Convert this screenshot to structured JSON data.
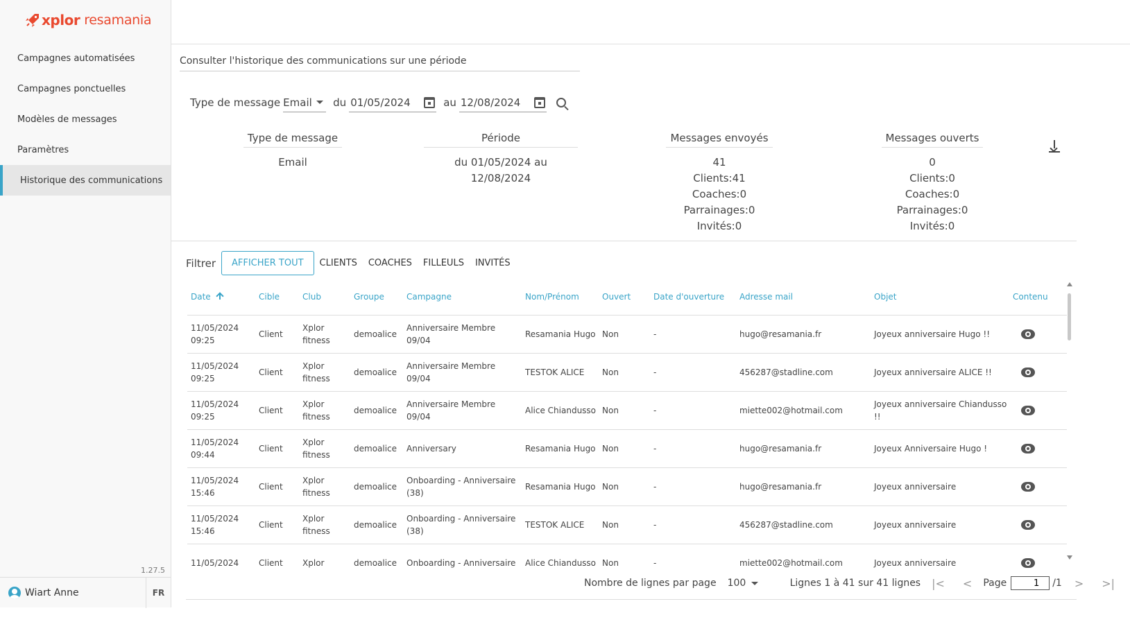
{
  "sidebar": {
    "logo_brand": "xplor",
    "logo_product": "resamania",
    "items": [
      {
        "label": "Campagnes automatisées"
      },
      {
        "label": "Campagnes ponctuelles"
      },
      {
        "label": "Modèles de messages"
      },
      {
        "label": "Paramètres"
      },
      {
        "label": "Historique des communications"
      }
    ],
    "version": "1.27.5",
    "user": "Wiart Anne",
    "lang": "FR"
  },
  "page": {
    "title": "Consulter l'historique des communications sur une période"
  },
  "search": {
    "type_label": "Type de message",
    "type_value": "Email",
    "from_label": "du",
    "from_value": "01/05/2024",
    "to_label": "au",
    "to_value": "12/08/2024"
  },
  "summary": {
    "col1": {
      "head": "Type de message",
      "value": "Email"
    },
    "col2": {
      "head": "Période",
      "value": "du 01/05/2024 au 12/08/2024"
    },
    "col3": {
      "head": "Messages envoyés",
      "lines": [
        "41",
        "Clients:41",
        "Coaches:0",
        "Parrainages:0",
        "Invités:0"
      ]
    },
    "col4": {
      "head": "Messages ouverts",
      "lines": [
        "0",
        "Clients:0",
        "Coaches:0",
        "Parrainages:0",
        "Invités:0"
      ]
    }
  },
  "filter": {
    "label": "Filtrer",
    "chips": [
      "AFFICHER TOUT",
      "CLIENTS",
      "COACHES",
      "FILLEULS",
      "INVITÉS"
    ]
  },
  "table": {
    "headers": [
      "Date",
      "Cible",
      "Club",
      "Groupe",
      "Campagne",
      "Nom/Prénom",
      "Ouvert",
      "Date d'ouverture",
      "Adresse mail",
      "Objet",
      "Contenu"
    ],
    "rows": [
      {
        "date": "11/05/2024",
        "time": "09:25",
        "cible": "Client",
        "club1": "Xplor",
        "club2": "fitness",
        "groupe": "demoalice",
        "campagne": "Anniversaire Membre 09/04",
        "nom": "Resamania Hugo",
        "ouvert": "Non",
        "date_ouv": "-",
        "mail": "hugo@resamania.fr",
        "objet": "Joyeux anniversaire Hugo !!"
      },
      {
        "date": "11/05/2024",
        "time": "09:25",
        "cible": "Client",
        "club1": "Xplor",
        "club2": "fitness",
        "groupe": "demoalice",
        "campagne": "Anniversaire Membre 09/04",
        "nom": "TESTOK ALICE",
        "ouvert": "Non",
        "date_ouv": "-",
        "mail": "456287@stadline.com",
        "objet": "Joyeux anniversaire ALICE !!"
      },
      {
        "date": "11/05/2024",
        "time": "09:25",
        "cible": "Client",
        "club1": "Xplor",
        "club2": "fitness",
        "groupe": "demoalice",
        "campagne": "Anniversaire Membre 09/04",
        "nom": "Alice Chiandusso",
        "ouvert": "Non",
        "date_ouv": "-",
        "mail": "miette002@hotmail.com",
        "objet": "Joyeux anniversaire Chiandusso !!"
      },
      {
        "date": "11/05/2024",
        "time": "09:44",
        "cible": "Client",
        "club1": "Xplor",
        "club2": "fitness",
        "groupe": "demoalice",
        "campagne": "Anniversary",
        "nom": "Resamania Hugo",
        "ouvert": "Non",
        "date_ouv": "-",
        "mail": "hugo@resamania.fr",
        "objet": "Joyeux Anniversaire Hugo !"
      },
      {
        "date": "11/05/2024",
        "time": "15:46",
        "cible": "Client",
        "club1": "Xplor",
        "club2": "fitness",
        "groupe": "demoalice",
        "campagne": "Onboarding - Anniversaire (38)",
        "nom": "Resamania Hugo",
        "ouvert": "Non",
        "date_ouv": "-",
        "mail": "hugo@resamania.fr",
        "objet": "Joyeux anniversaire"
      },
      {
        "date": "11/05/2024",
        "time": "15:46",
        "cible": "Client",
        "club1": "Xplor",
        "club2": "fitness",
        "groupe": "demoalice",
        "campagne": "Onboarding - Anniversaire (38)",
        "nom": "TESTOK ALICE",
        "ouvert": "Non",
        "date_ouv": "-",
        "mail": "456287@stadline.com",
        "objet": "Joyeux anniversaire"
      },
      {
        "date": "11/05/2024",
        "time": "",
        "cible": "Client",
        "club1": "Xplor",
        "club2": "",
        "groupe": "demoalice",
        "campagne": "Onboarding - Anniversaire",
        "nom": "Alice Chiandusso",
        "ouvert": "Non",
        "date_ouv": "-",
        "mail": "miette002@hotmail.com",
        "objet": "Joyeux anniversaire"
      }
    ]
  },
  "pager": {
    "rows_label": "Nombre de lignes par page",
    "rows_value": "100",
    "range": "Lignes 1 à 41 sur 41 lignes",
    "page_label": "Page",
    "page_value": "1",
    "page_total": "/1"
  },
  "colors": {
    "accent": "#39a4c8",
    "brand": "#e9492f"
  }
}
